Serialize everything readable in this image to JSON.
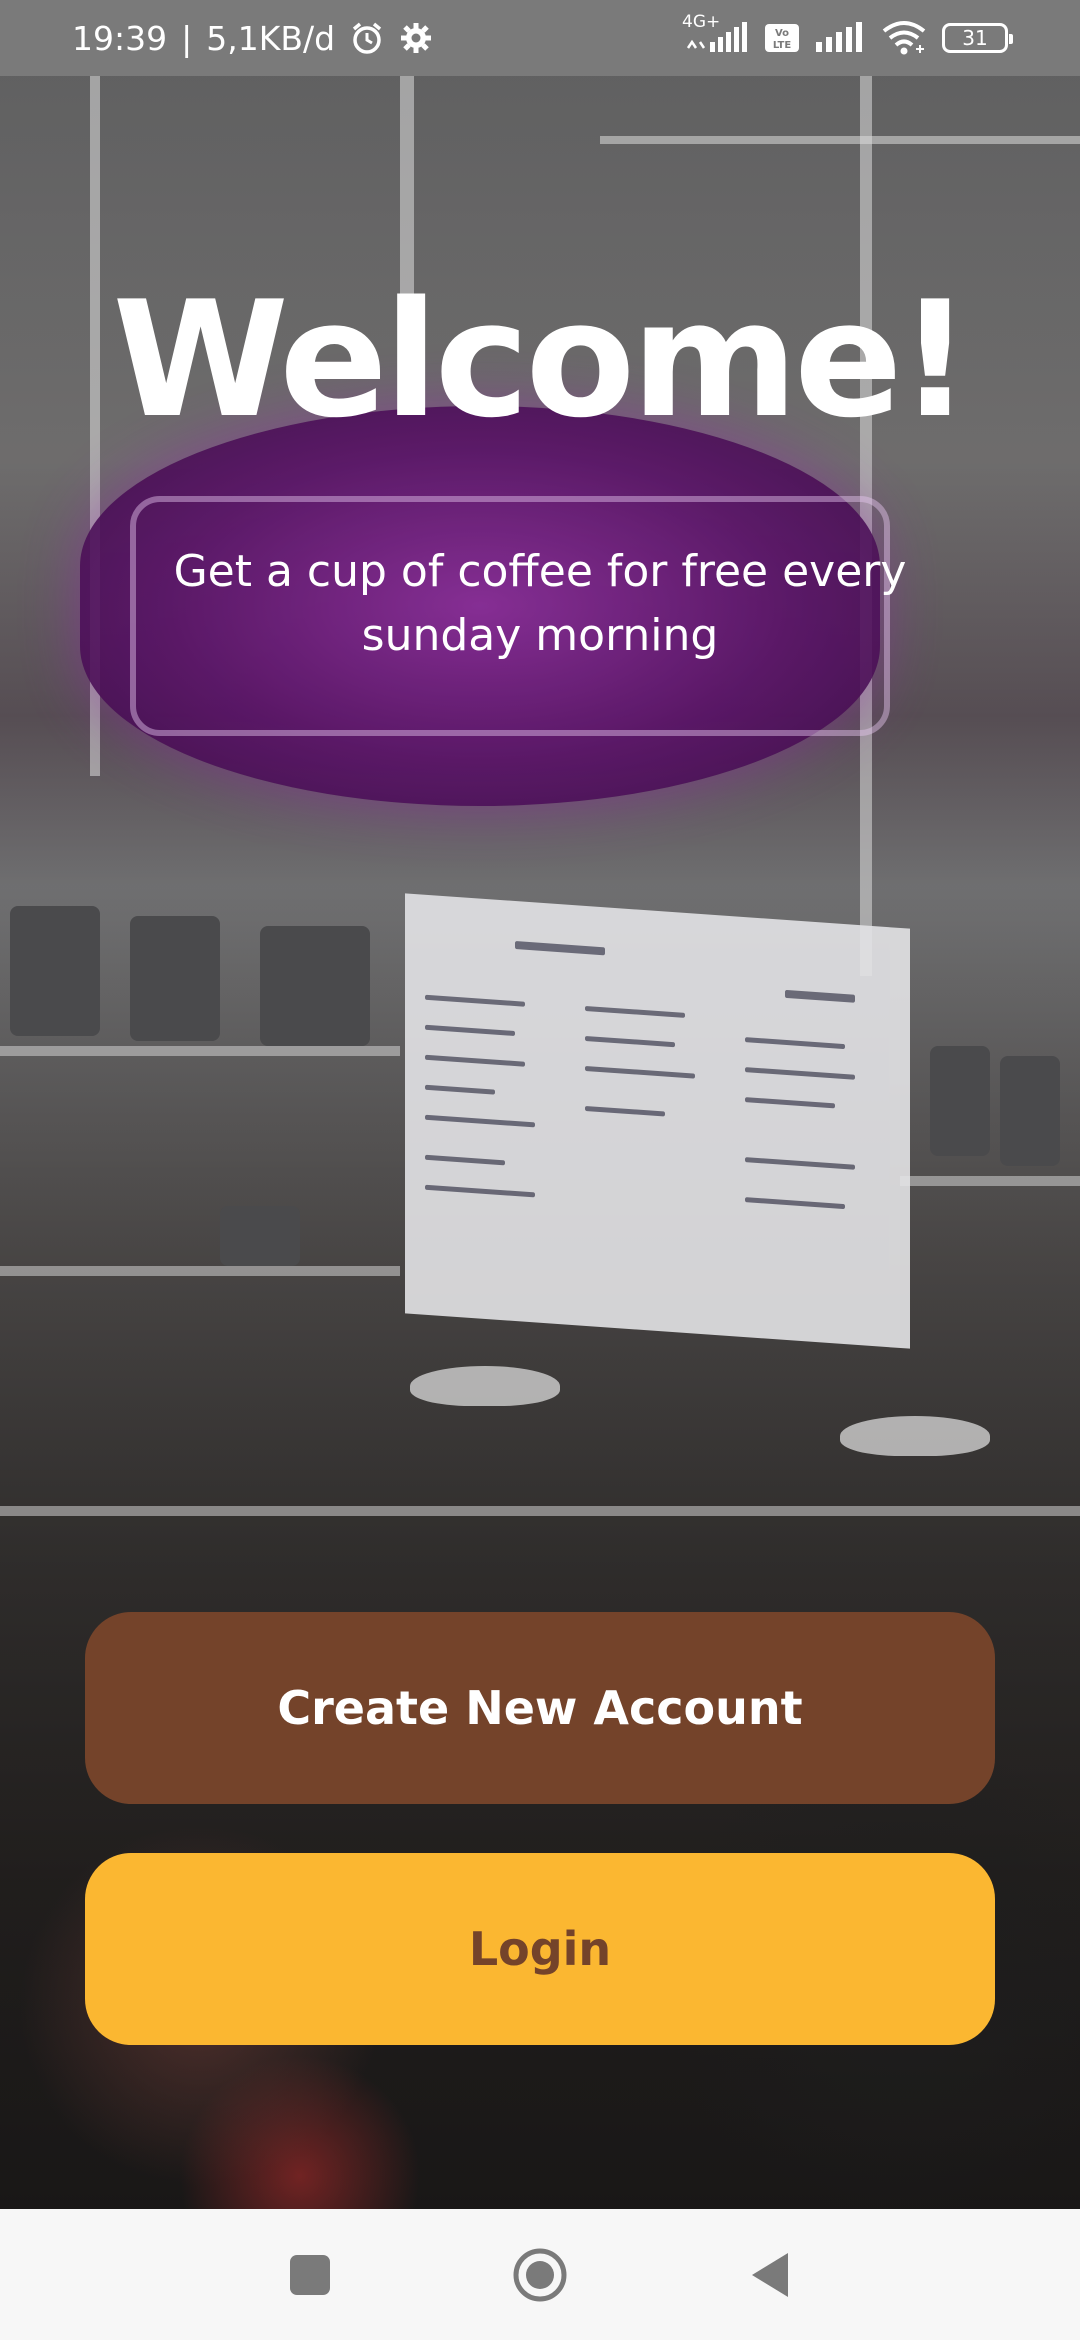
{
  "status_bar": {
    "time": "19:39",
    "separator": "|",
    "data_speed": "5,1KB/d",
    "network_type": "4G+",
    "volte_label": "Vo LTE",
    "battery_level": "31",
    "icons": [
      "alarm-icon",
      "settings-gear-icon",
      "signal-icon",
      "volte-icon",
      "signal-icon",
      "wifi-icon",
      "battery-icon"
    ]
  },
  "welcome": {
    "title": "Welcome!",
    "subtitle": "Get a cup of coffee for free every sunday morning"
  },
  "actions": {
    "create_account_label": "Create New Account",
    "login_label": "Login"
  },
  "colors": {
    "create_button_bg": "#74432a",
    "login_button_bg": "#fbb731",
    "login_button_text": "#74432a"
  },
  "nav": {
    "icons": [
      "recents-square-icon",
      "home-circle-icon",
      "back-triangle-icon"
    ]
  }
}
